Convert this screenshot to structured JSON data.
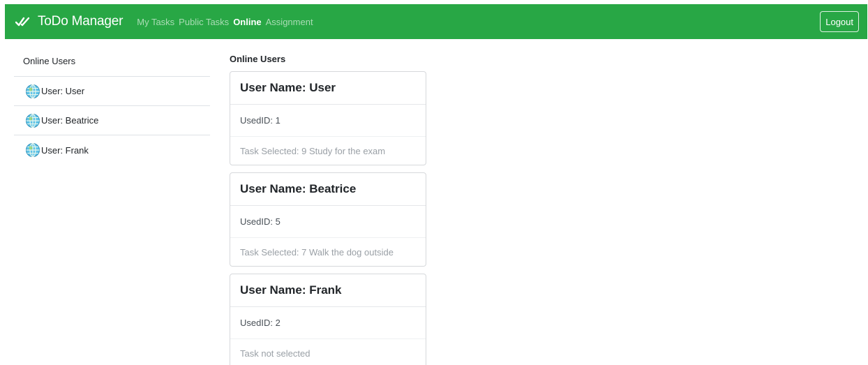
{
  "navbar": {
    "brand": "ToDo Manager",
    "links": [
      {
        "label": "My Tasks",
        "active": false
      },
      {
        "label": "Public Tasks",
        "active": false
      },
      {
        "label": "Online",
        "active": true
      },
      {
        "label": "Assignment",
        "active": false
      }
    ],
    "logout_label": "Logout",
    "color": "#28a745"
  },
  "sidebar": {
    "header": "Online Users",
    "items": [
      {
        "label": "User: User",
        "icon": "globe-icon"
      },
      {
        "label": "User: Beatrice",
        "icon": "globe-icon"
      },
      {
        "label": "User: Frank",
        "icon": "globe-icon"
      }
    ]
  },
  "main": {
    "title": "Online Users",
    "cards": [
      {
        "name": "User Name: User",
        "id": "UsedID: 1",
        "task": "Task Selected: 9 Study for the exam"
      },
      {
        "name": "User Name: Beatrice",
        "id": "UsedID: 5",
        "task": "Task Selected: 7 Walk the dog outside"
      },
      {
        "name": "User Name: Frank",
        "id": "UsedID: 2",
        "task": "Task not selected"
      }
    ]
  }
}
